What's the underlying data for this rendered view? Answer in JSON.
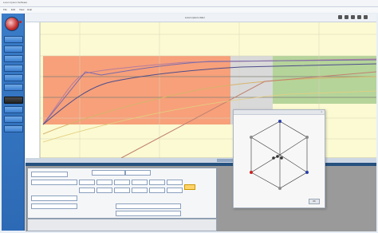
{
  "title_bar": {
    "text": "Lorem Ipsum Software"
  },
  "menu": [
    {
      "label": "File"
    },
    {
      "label": "Edit"
    },
    {
      "label": "View"
    },
    {
      "label": "Help"
    }
  ],
  "sidebar": {
    "buttons": [
      {
        "label": ""
      },
      {
        "label": ""
      },
      {
        "label": ""
      },
      {
        "label": ""
      },
      {
        "label": ""
      },
      {
        "label": ""
      },
      {
        "label": ""
      },
      {
        "label": ""
      },
      {
        "label": ""
      },
      {
        "label": ""
      },
      {
        "label": ""
      },
      {
        "label": ""
      }
    ]
  },
  "chart": {
    "title": "Lorem ipsum dolor"
  },
  "popup": {
    "title": "",
    "close_label": "x",
    "footer_button": "OK"
  },
  "colors": {
    "zone_red": "#f7a07a",
    "zone_grey": "#d9d9d9",
    "zone_green": "#b5d49a",
    "background_yellow": "#fbfad2"
  }
}
